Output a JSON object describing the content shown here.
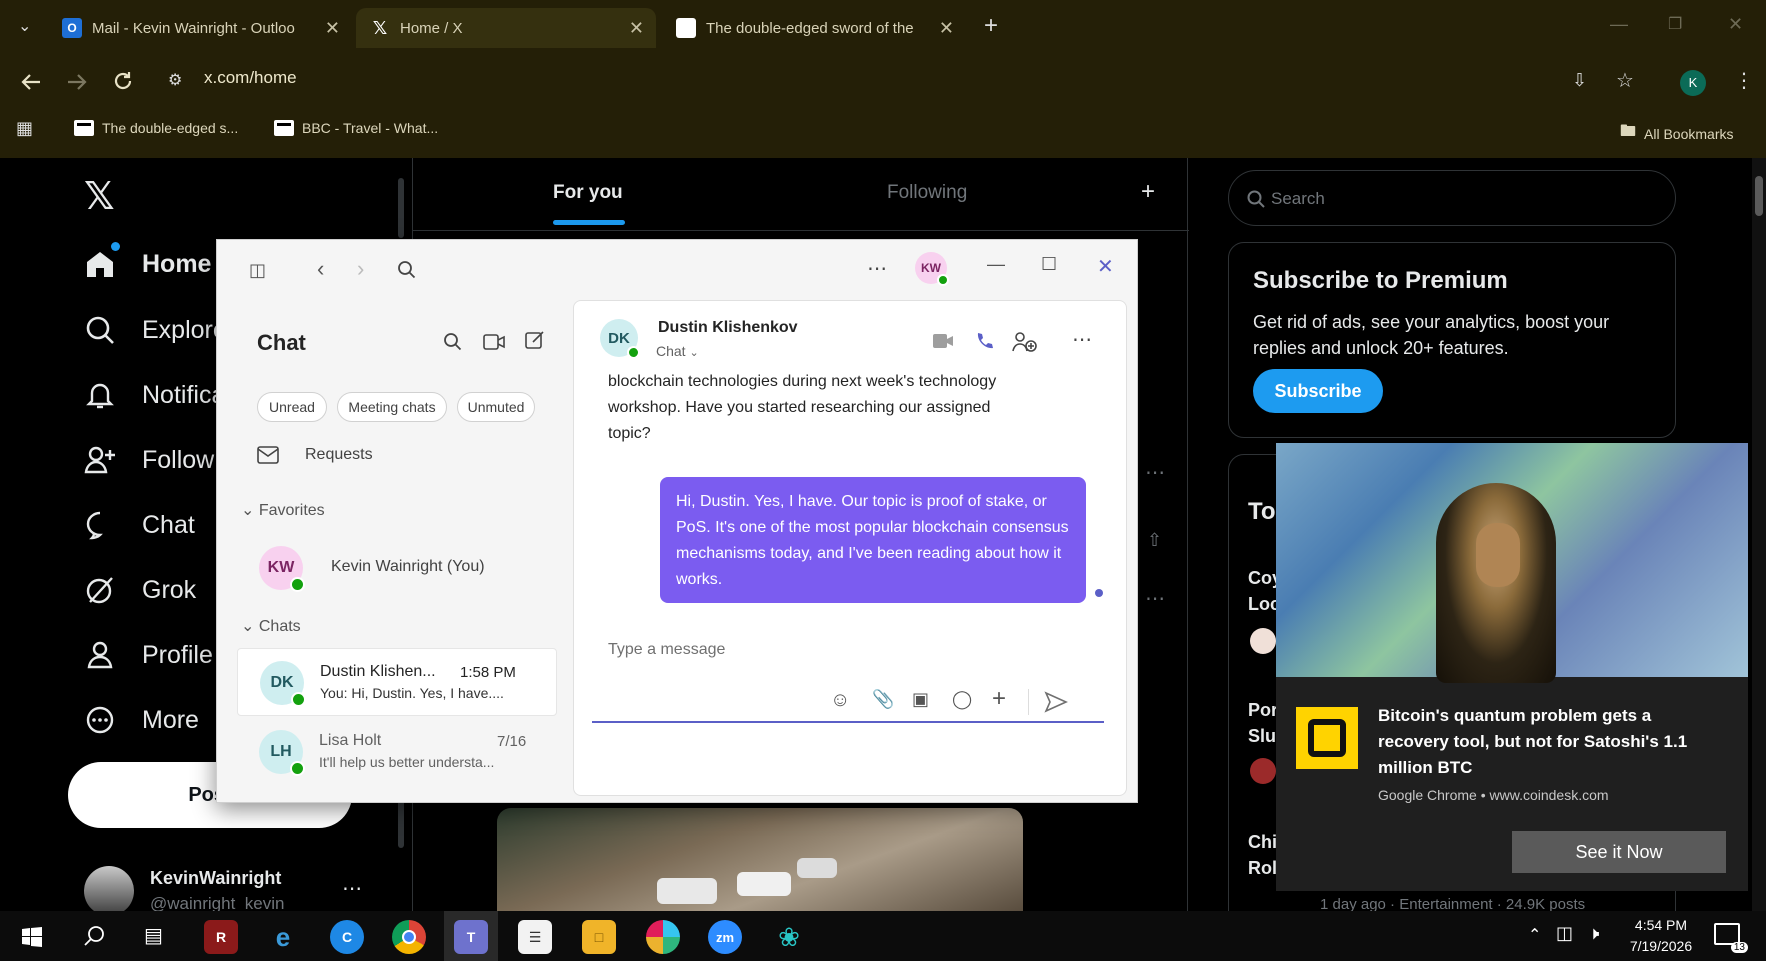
{
  "browser": {
    "tabs": [
      {
        "title": "Mail - Kevin Wainright - Outloo",
        "icon": "outlook-icon"
      },
      {
        "title": "Home / X",
        "icon": "x-logo-icon"
      },
      {
        "title": "The double-edged sword of the",
        "icon": "news-icon"
      }
    ],
    "url": "x.com/home",
    "bookmarks": [
      "The double-edged s...",
      "BBC - Travel - What..."
    ],
    "all_bookmarks": "All Bookmarks",
    "profile_initial": "K"
  },
  "x": {
    "nav": [
      "Home",
      "Explore",
      "Notifications",
      "Follow",
      "Chat",
      "Grok",
      "Profile",
      "More"
    ],
    "post_button": "Post",
    "feed_tabs": [
      "For you",
      "Following"
    ],
    "search_placeholder": "Search",
    "premium": {
      "title": "Subscribe to Premium",
      "text": "Get rid of ads, see your analytics, boost your replies and unlock 20+ features.",
      "button": "Subscribe"
    },
    "trends_title": "To",
    "trend_fragments": [
      "Coy",
      "Loc",
      "Por",
      "Slu",
      "Chi",
      "Rol"
    ],
    "trend_meta": "1 day ago · Entertainment · 24.9K posts",
    "user": {
      "name": "KevinWainright",
      "handle": "@wainright_kevin"
    }
  },
  "teams": {
    "owner_initials": "KW",
    "sidebar_title": "Chat",
    "filters": [
      "Unread",
      "Meeting chats",
      "Unmuted"
    ],
    "requests": "Requests",
    "favorites_label": "Favorites",
    "favorite": {
      "initials": "KW",
      "name": "Kevin Wainright (You)"
    },
    "chats_label": "Chats",
    "chats": [
      {
        "initials": "DK",
        "name": "Dustin Klishen...",
        "time": "1:58 PM",
        "preview": "You: Hi, Dustin. Yes, I have...."
      },
      {
        "initials": "LH",
        "name": "Lisa Holt",
        "time": "7/16",
        "preview": "It'll help us better understa..."
      }
    ],
    "conversation": {
      "initials": "DK",
      "name": "Dustin Klishenkov",
      "subtitle": "Chat",
      "incoming": "blockchain technologies during next week's technology workshop. Have you started researching our assigned topic?",
      "outgoing": "Hi, Dustin. Yes, I have. Our topic is proof of stake, or PoS. It's one of the most popular blockchain consensus mechanisms today, and I've been reading about how it works.",
      "compose_placeholder": "Type a message"
    }
  },
  "notification": {
    "headline": "Bitcoin's quantum problem gets a recovery tool, but not for Satoshi's 1.1 million BTC",
    "source": "Google Chrome • www.coindesk.com",
    "button": "See it Now"
  },
  "taskbar": {
    "time": "4:54 PM",
    "date": "7/19/2026",
    "notifications_count": "13"
  },
  "colors": {
    "chrome_bg": "#241f07",
    "x_accent": "#1d9bf0",
    "teams_purple": "#7b5cf0",
    "teams_avatar_dk": "#cfeef0",
    "teams_avatar_kw": "#f8d1ef"
  }
}
